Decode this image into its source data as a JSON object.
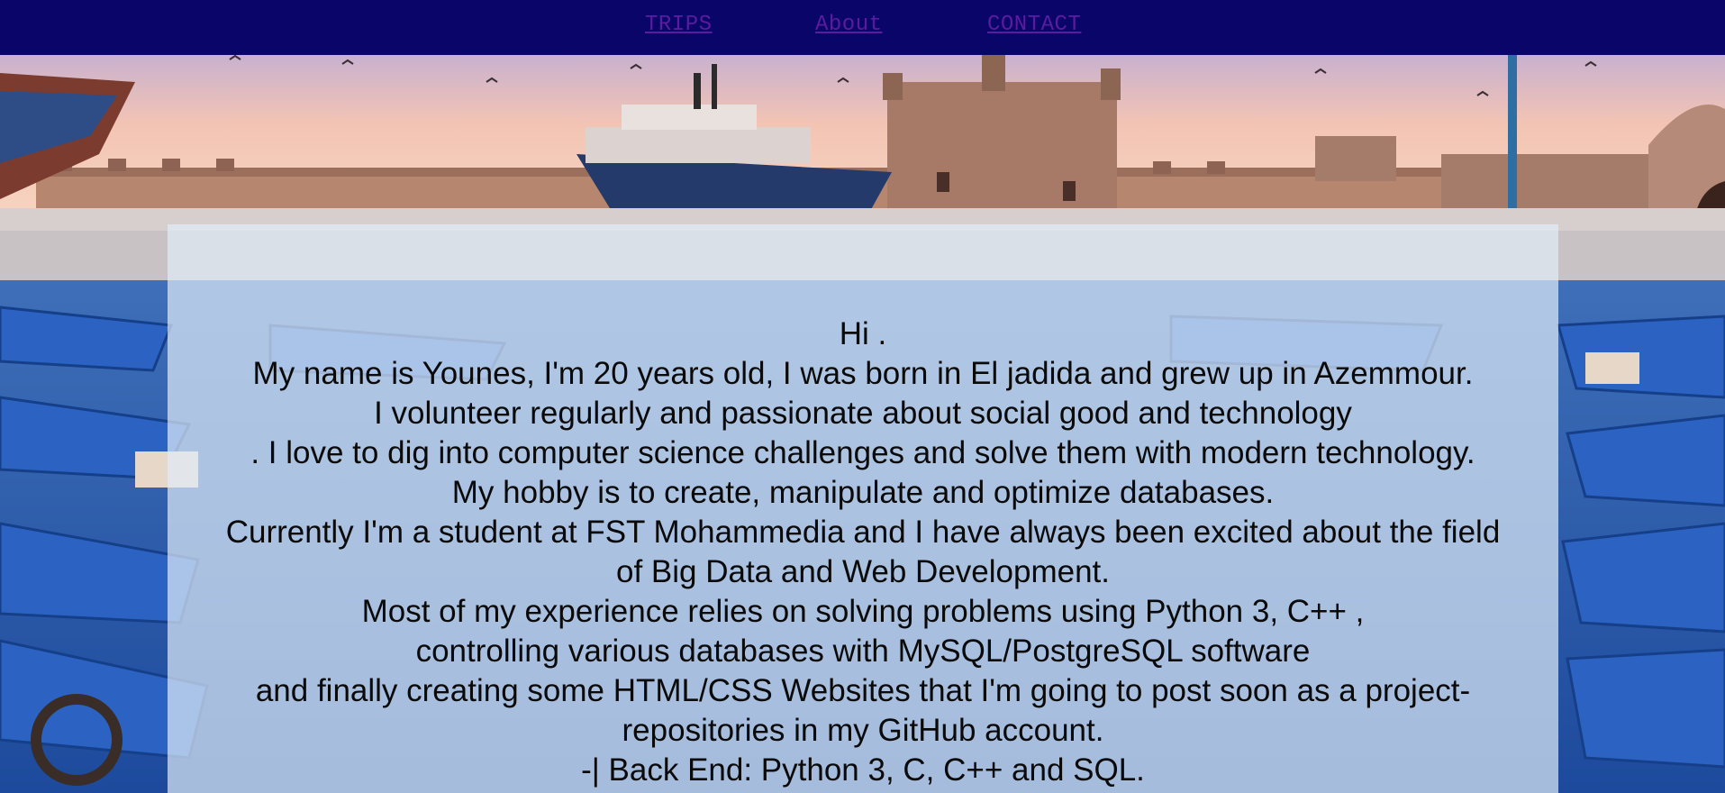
{
  "nav": {
    "items": [
      {
        "label": "TRIPS"
      },
      {
        "label": "About"
      },
      {
        "label": "CONTACT"
      }
    ],
    "link_color": "#5b1b9e",
    "background": "#0a0568"
  },
  "hero": {
    "description": "Essaouira harbor with blue fishing boats"
  },
  "about": {
    "lines": [
      "Hi .",
      "My name is Younes, I'm 20 years old, I was born in El jadida and grew up in Azemmour.",
      "I volunteer regularly and passionate about social good and technology",
      ". I love to dig into computer science challenges and solve them with modern technology.",
      "My hobby is to create, manipulate and optimize databases.",
      "Currently I'm a student at FST Mohammedia and I have always been excited about the field",
      "of Big Data and Web Development.",
      "Most of my experience relies on solving problems using Python 3, C++ ,",
      "controlling various databases with MySQL/PostgreSQL software",
      "and finally creating some HTML/CSS Websites that I'm going to post soon as a project-",
      "repositories in my GitHub account.",
      "-| Back End: Python 3, C, C++ and SQL."
    ]
  }
}
